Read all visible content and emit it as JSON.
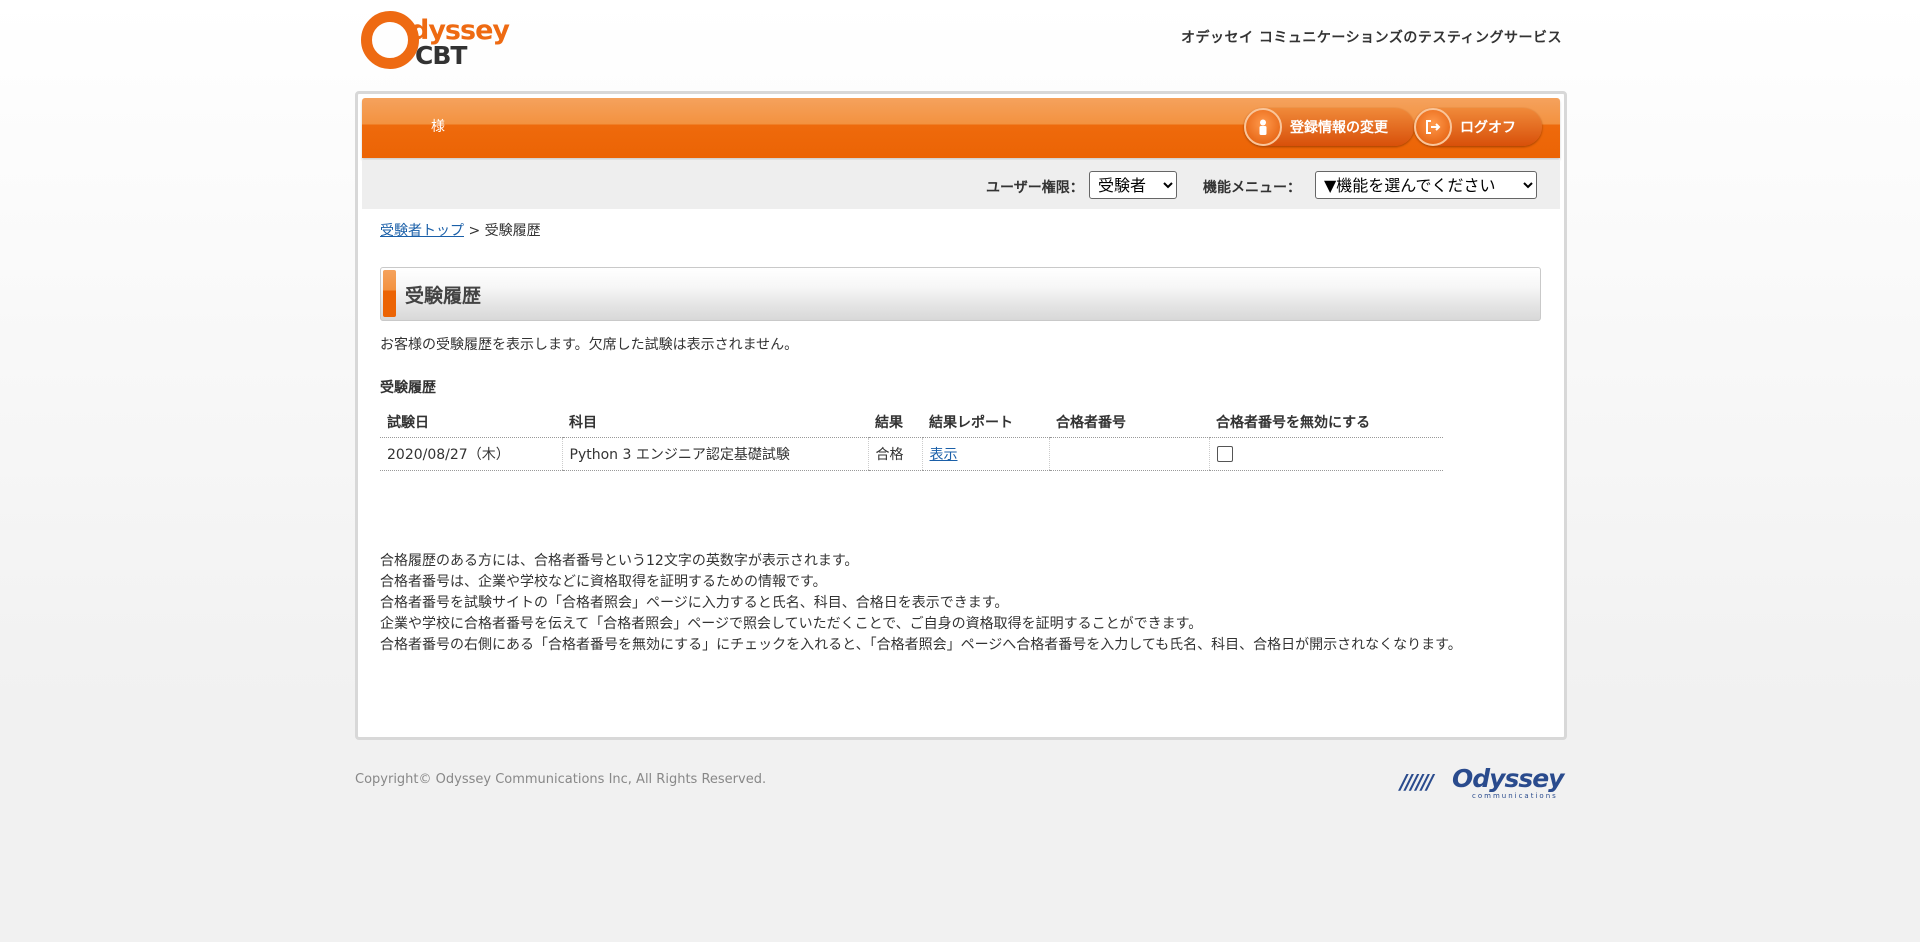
{
  "header": {
    "logo_word1": "dyssey",
    "logo_word2": "CBT",
    "tagline": "オデッセイ コミュニケーションズのテスティングサービス"
  },
  "user_bar": {
    "user_name": "様",
    "register_button": "登録情報の変更",
    "logoff_button": "ログオフ"
  },
  "toolbar": {
    "role_label": "ユーザー権限：",
    "role_value": "受験者",
    "menu_label": "機能メニュー：",
    "menu_value": "▼機能を選んでください"
  },
  "breadcrumb": {
    "home": "受験者トップ",
    "separator": ">",
    "current": "受験履歴"
  },
  "page_title": "受験履歴",
  "description": "お客様の受験履歴を表示します。欠席した試験は表示されません。",
  "history_heading": "受験履歴",
  "table": {
    "headers": [
      "試験日",
      "科目",
      "結果",
      "結果レポート",
      "合格者番号",
      "合格者番号を無効にする"
    ],
    "rows": [
      {
        "date": "2020/08/27（木）",
        "subject": "Python 3 エンジニア認定基礎試験",
        "result": "合格",
        "report": "表示",
        "pass_number": "",
        "disable_checked": false
      }
    ]
  },
  "notes": [
    "合格履歴のある方には、合格者番号という12文字の英数字が表示されます。",
    "合格者番号は、企業や学校などに資格取得を証明するための情報です。",
    "合格者番号を試験サイトの「合格者照会」ページに入力すると氏名、科目、合格日を表示できます。",
    "企業や学校に合格者番号を伝えて「合格者照会」ページで照会していただくことで、ご自身の資格取得を証明することができます。",
    "合格者番号の右側にある「合格者番号を無効にする」にチェックを入れると、「合格者照会」ページへ合格者番号を入力しても氏名、科目、合格日が開示されなくなります。"
  ],
  "footer": {
    "copyright": "Copyright© Odyssey Communications Inc, All Rights Reserved.",
    "logo_stripes": "//////",
    "logo_name": "Odyssey",
    "logo_small": "communications"
  },
  "colors": {
    "accent": "#ee6a12",
    "link": "#1a5fa8",
    "footer_logo": "#2a4b8d"
  }
}
